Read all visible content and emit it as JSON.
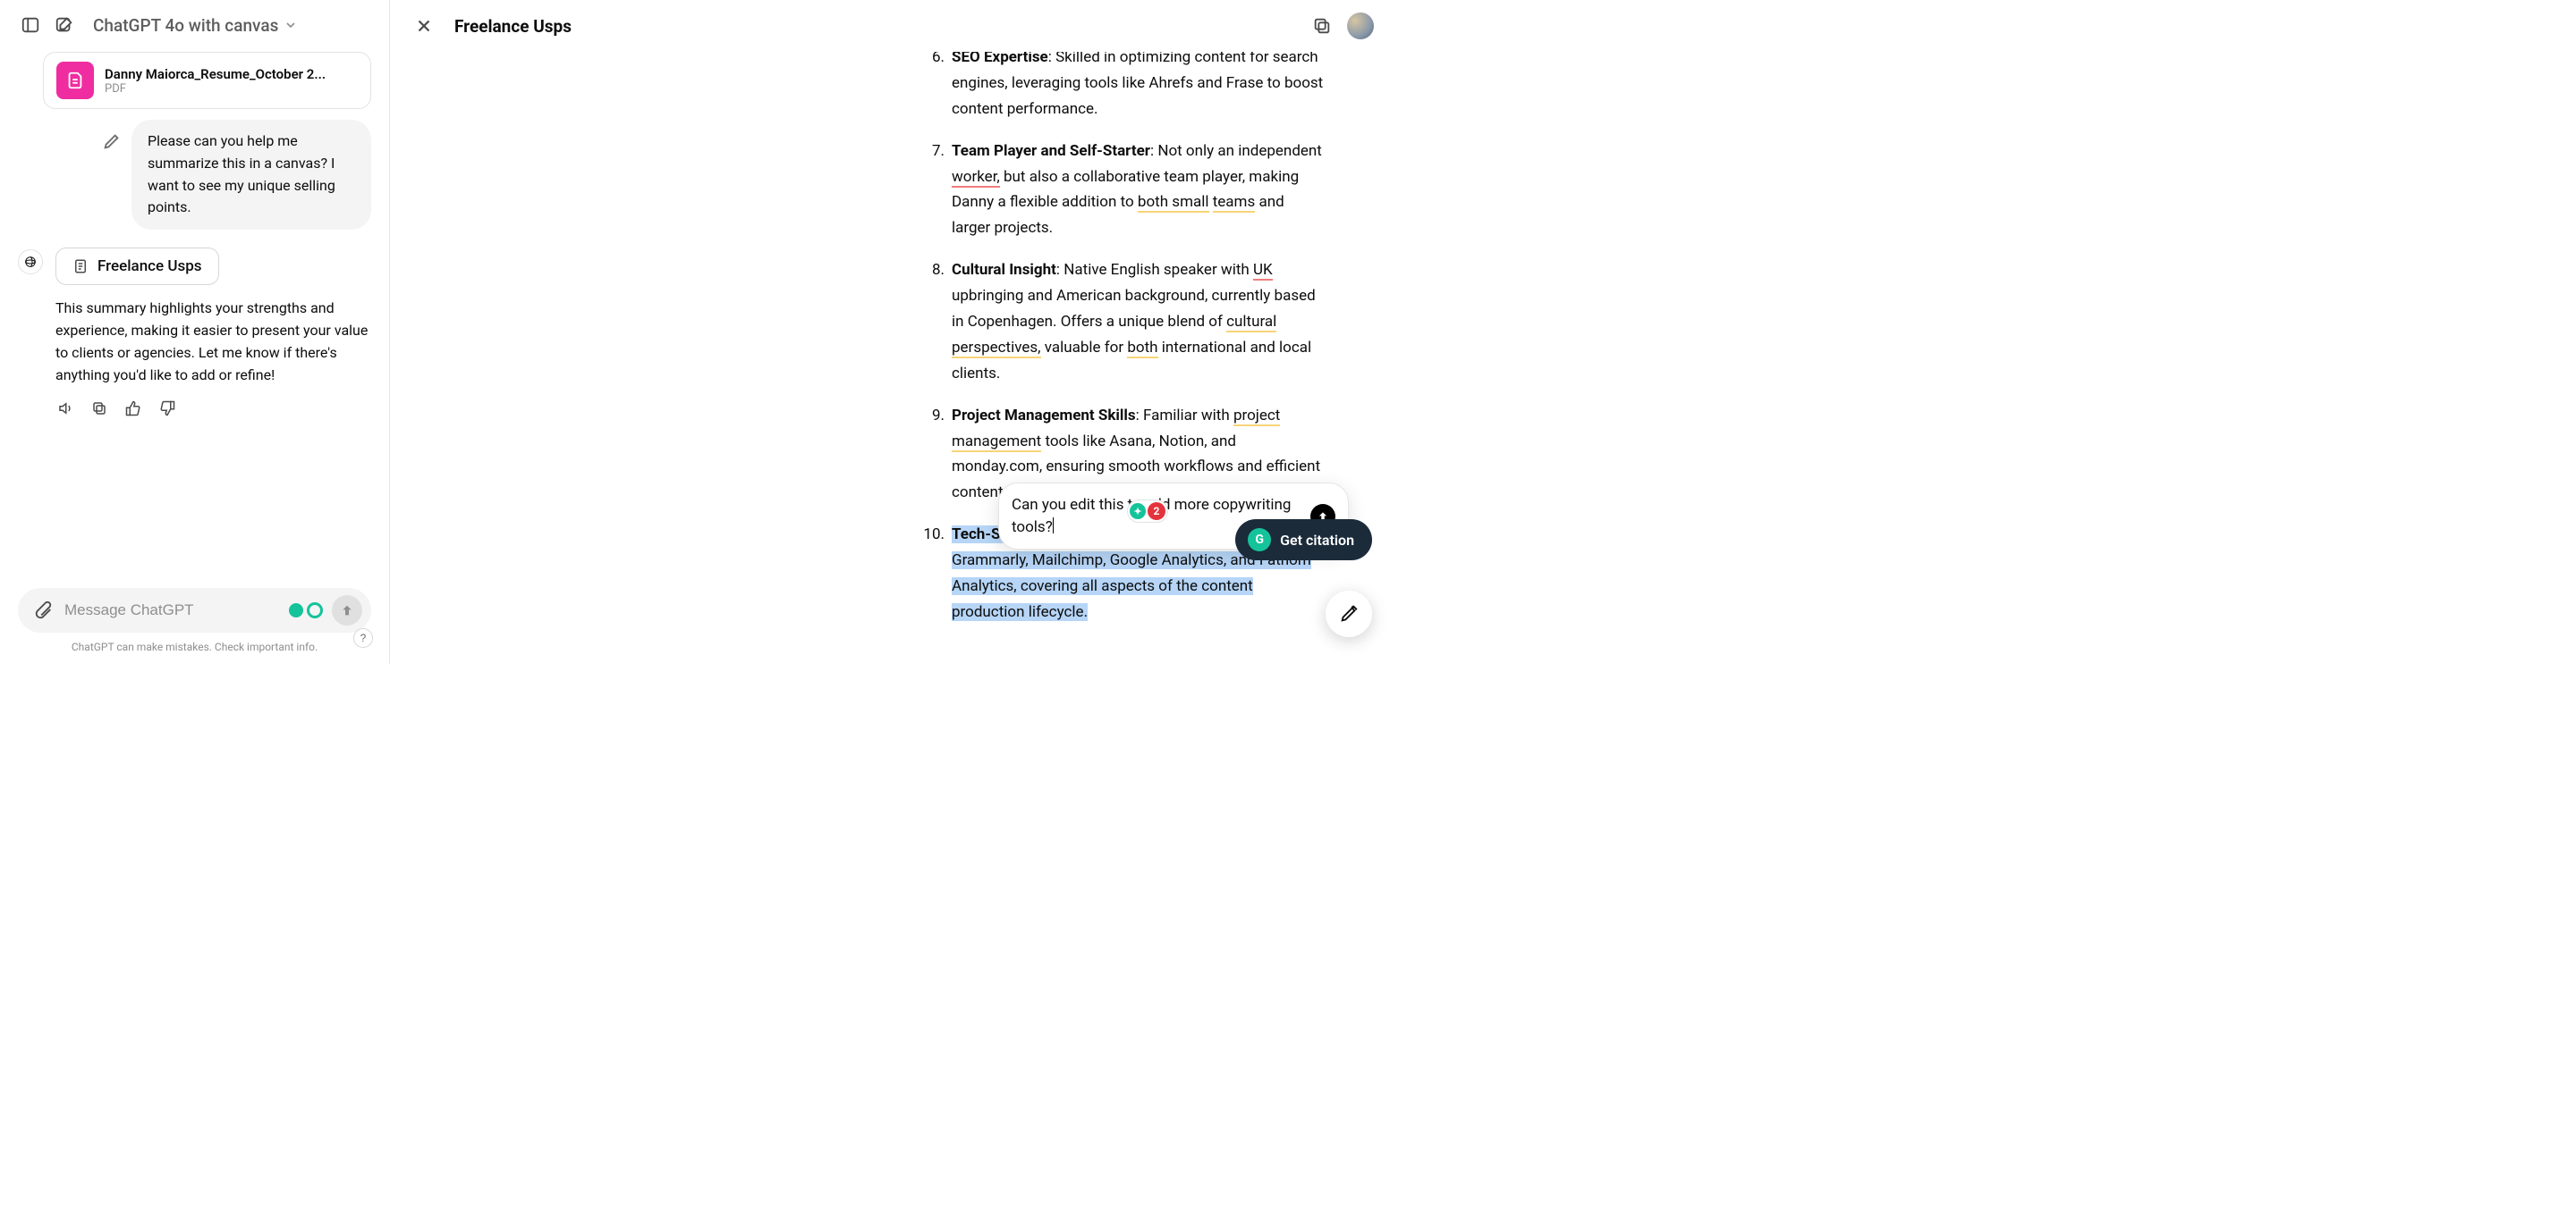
{
  "header": {
    "model_label": "ChatGPT 4o with canvas"
  },
  "attachment": {
    "filename": "Danny Maiorca_Resume_October 2...",
    "filetype": "PDF"
  },
  "conversation": {
    "user_message": "Please can you help me summarize this in a canvas? I want to see my unique selling points.",
    "canvas_chip_label": "Freelance Usps",
    "assistant_message": "This summary highlights your strengths and experience, making it easier to present your value to clients or agencies. Let me know if there's anything you'd like to add or refine!"
  },
  "composer": {
    "placeholder": "Message ChatGPT",
    "disclaimer": "ChatGPT can make mistakes. Check important info.",
    "help_label": "?"
  },
  "canvas": {
    "title": "Freelance Usps",
    "list": {
      "i6": {
        "b": "SEO Expertise",
        "t": ": Skilled in optimizing content for search engines, leveraging tools like Ahrefs and Frase to boost content performance."
      },
      "i7": {
        "b": "Team Player and Self-Starter",
        "pre": ": Not only an independent ",
        "worker": "worker,",
        "mid1": " but also a collaborative team player, making Danny a flexible addition to ",
        "both_small": "both small",
        "nl": " ",
        "teams": "teams",
        "post": " and larger projects."
      },
      "i8": {
        "b": "Cultural Insight",
        "pre": ": Native English speaker with ",
        "uk": "UK",
        "mid1": " upbringing and American background, currently based in Copenhagen. Offers a unique blend of ",
        "cultural": "cultural perspectives,",
        "mid2": " valuable for ",
        "both": "both",
        "post": " international and local clients."
      },
      "i9": {
        "b": "Project Management Skills",
        "pre": ": Familiar with ",
        "pm": "project management",
        "post": " tools like Asana, Notion, and monday.com, ensuring smooth workflows and efficient content delivery."
      },
      "i10": {
        "b": "Tech-Savvy",
        "t": ": Proficient in tools like WordPress, Grammarly, Mailchimp, Google Analytics, and Fathom Analytics, covering all aspects of the content production lifecycle."
      }
    },
    "inline_edit_value": "Can you edit this to add more copywriting tools?",
    "grammarly_count": "2",
    "citation_label": "Get citation"
  }
}
